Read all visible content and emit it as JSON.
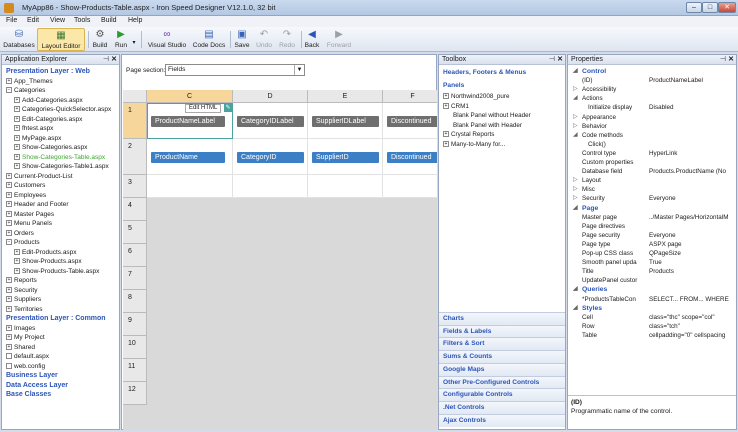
{
  "window": {
    "title": "MyApp86 - Show-Products-Table.aspx - Iron Speed Designer V12.1.0, 32 bit",
    "min": "–",
    "max": "□",
    "close": "✕"
  },
  "menu": [
    "File",
    "Edit",
    "View",
    "Tools",
    "Build",
    "Help"
  ],
  "toolbar": {
    "databases": "Databases",
    "layout_editor": "Layout Editor",
    "build": "Build",
    "run": "Run",
    "visual_studio": "Visual Studio",
    "code_docs": "Code Docs",
    "save": "Save",
    "undo": "Undo",
    "redo": "Redo",
    "back": "Back",
    "forward": "Forward"
  },
  "explorer": {
    "title": "Application Explorer",
    "items": [
      {
        "text": "Presentation Layer : Web",
        "type": "section"
      },
      {
        "text": "App_Themes",
        "box": "+",
        "indent": 1
      },
      {
        "text": "Categories",
        "box": "−",
        "indent": 1
      },
      {
        "text": "Add-Categories.aspx",
        "box": "+",
        "indent": 2
      },
      {
        "text": "Categories-QuickSelector.aspx",
        "box": "+",
        "indent": 2
      },
      {
        "text": "Edit-Categories.aspx",
        "box": "+",
        "indent": 2
      },
      {
        "text": "fhtest.aspx",
        "box": "+",
        "indent": 2
      },
      {
        "text": "MyPage.aspx",
        "box": "+",
        "indent": 2
      },
      {
        "text": "Show-Categories.aspx",
        "box": "+",
        "indent": 2
      },
      {
        "text": "Show-Categories-Table.aspx",
        "box": "+",
        "indent": 2,
        "green": true
      },
      {
        "text": "Show-Categories-Table1.aspx",
        "box": "+",
        "indent": 2
      },
      {
        "text": "Current-Product-List",
        "box": "+",
        "indent": 1
      },
      {
        "text": "Customers",
        "box": "+",
        "indent": 1
      },
      {
        "text": "Employees",
        "box": "+",
        "indent": 1
      },
      {
        "text": "Header and Footer",
        "box": "+",
        "indent": 1
      },
      {
        "text": "Master Pages",
        "box": "+",
        "indent": 1
      },
      {
        "text": "Menu Panels",
        "box": "+",
        "indent": 1
      },
      {
        "text": "Orders",
        "box": "+",
        "indent": 1
      },
      {
        "text": "Products",
        "box": "−",
        "indent": 1
      },
      {
        "text": "Edit-Products.aspx",
        "box": "+",
        "indent": 2
      },
      {
        "text": "Show-Products.aspx",
        "box": "+",
        "indent": 2
      },
      {
        "text": "Show-Products-Table.aspx",
        "box": "+",
        "indent": 2
      },
      {
        "text": "Reports",
        "box": "+",
        "indent": 1
      },
      {
        "text": "Security",
        "box": "+",
        "indent": 1
      },
      {
        "text": "Suppliers",
        "box": "+",
        "indent": 1
      },
      {
        "text": "Territories",
        "box": "+",
        "indent": 1
      },
      {
        "text": "Presentation Layer : Common",
        "type": "section"
      },
      {
        "text": "Images",
        "box": "+",
        "indent": 1
      },
      {
        "text": "My Project",
        "box": "+",
        "indent": 1
      },
      {
        "text": "Shared",
        "box": "+",
        "indent": 1
      },
      {
        "text": "default.aspx",
        "indent": 1
      },
      {
        "text": "web.config",
        "indent": 1
      },
      {
        "text": "Business Layer",
        "type": "section"
      },
      {
        "text": "Data Access Layer",
        "type": "section"
      },
      {
        "text": "Base Classes",
        "type": "section"
      }
    ]
  },
  "designer": {
    "page_section_label": "Page section:",
    "page_section_value": "Fields",
    "columns": [
      "C",
      "D",
      "E",
      "F"
    ],
    "rows": [
      "1",
      "2",
      "3",
      "4",
      "5",
      "6",
      "7",
      "8",
      "9",
      "10",
      "11",
      "12"
    ],
    "edit_html": "Edit HTML",
    "row1": [
      "ProductNameLabel",
      "CategoryIDLabel",
      "SupplierIDLabel",
      "Discontinued"
    ],
    "row2": [
      "ProductName",
      "CategoryID",
      "SupplierID",
      "Discontinued"
    ]
  },
  "toolbox": {
    "title": "Toolbox",
    "top_sections": [
      "Headers, Footers & Menus",
      "Panels"
    ],
    "items": [
      {
        "text": "Northwind2008_pure",
        "box": "+"
      },
      {
        "text": "CRM1",
        "box": "+"
      },
      {
        "text": "Blank Panel without Header"
      },
      {
        "text": "Blank Panel with Header"
      },
      {
        "text": "Crystal Reports",
        "box": "+"
      },
      {
        "text": "Many-to-Many for...",
        "box": "+"
      }
    ],
    "bottom_sections": [
      "Charts",
      "Fields & Labels",
      "Filters & Sort",
      "Sums & Counts",
      "Google Maps",
      "Other Pre-Configured Controls",
      "Configurable Controls",
      ".Net Controls",
      "Ajax Controls"
    ]
  },
  "properties": {
    "title": "Properties",
    "rows": [
      {
        "k": "Control",
        "cat": true,
        "exp": "◢"
      },
      {
        "k": "(ID)",
        "v": "ProductNameLabel"
      },
      {
        "k": "Accessibility",
        "exp": "▷"
      },
      {
        "k": "Actions",
        "exp": "◢"
      },
      {
        "k": "Initialize display",
        "v": "Disabled",
        "sub": true
      },
      {
        "k": "Appearance",
        "exp": "▷"
      },
      {
        "k": "Behavior",
        "exp": "▷"
      },
      {
        "k": "Code methods",
        "exp": "◢"
      },
      {
        "k": "Click()",
        "sub": true
      },
      {
        "k": "Control type",
        "v": "HyperLink"
      },
      {
        "k": "Custom properties"
      },
      {
        "k": "Database field",
        "v": "Products.ProductName (No"
      },
      {
        "k": "Layout",
        "exp": "▷"
      },
      {
        "k": "Misc",
        "exp": "▷"
      },
      {
        "k": "Security",
        "v": "Everyone",
        "exp": "▷"
      },
      {
        "k": "Page",
        "cat": true,
        "exp": "◢"
      },
      {
        "k": "Master page",
        "v": "../Master Pages/HorizontalM"
      },
      {
        "k": "Page directives"
      },
      {
        "k": "Page security",
        "v": "Everyone"
      },
      {
        "k": "Page type",
        "v": "ASPX page"
      },
      {
        "k": "Pop-up CSS class",
        "v": "QPageSize"
      },
      {
        "k": "Smooth panel upda",
        "v": "True"
      },
      {
        "k": "Title",
        "v": "Products"
      },
      {
        "k": "UpdatePanel custor"
      },
      {
        "k": "Queries",
        "cat": true,
        "exp": "◢"
      },
      {
        "k": "*ProductsTableCon",
        "v": "SELECT... FROM... WHERE"
      },
      {
        "k": "Styles",
        "cat": true,
        "exp": "◢"
      },
      {
        "k": "Cell",
        "v": "class=\"thc\" scope=\"col\""
      },
      {
        "k": "Row",
        "v": "class=\"tch\""
      },
      {
        "k": "Table",
        "v": "cellpadding=\"0\" cellspacing"
      }
    ],
    "desc_title": "(ID)",
    "desc_text": "Programmatic name of the control."
  }
}
